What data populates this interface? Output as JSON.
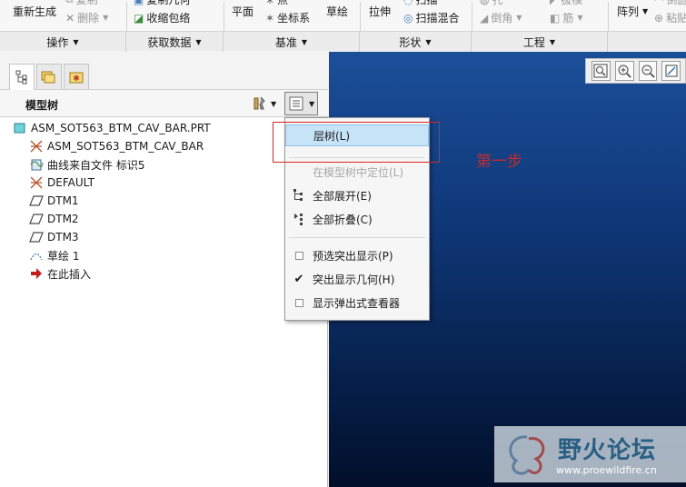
{
  "ribbon": {
    "row1": {
      "regenerate": "重新生成",
      "copy_geometry": "复制几何",
      "shrinkwrap": "收缩包络",
      "plane": "平面",
      "point": "点",
      "csys": "坐标系",
      "sketch": "草绘",
      "extrude": "拉伸",
      "sweep": "扫描",
      "swept_blend": "扫描混合",
      "hole": "孔",
      "draft": "拔模",
      "shell": "壳",
      "chamfer": "倒角",
      "round": "倒圆角",
      "rib": "筋",
      "pattern": "阵列",
      "copy": "复制",
      "paste": "粘贴",
      "delete": "删除"
    },
    "groups": {
      "operations": "操作",
      "get_data": "获取数据",
      "datum": "基准",
      "shapes": "形状",
      "engineering": "工程"
    }
  },
  "left_panel": {
    "tree_title": "模型树",
    "items": [
      "ASM_SOT563_BTM_CAV_BAR.PRT",
      "ASM_SOT563_BTM_CAV_BAR",
      "曲线来自文件 标识5",
      "DEFAULT",
      "DTM1",
      "DTM2",
      "DTM3",
      "草绘 1",
      "在此插入"
    ]
  },
  "menu": {
    "layer_tree": "层树(L)",
    "locate_in_tree": "在模型树中定位(L)",
    "expand_all": "全部展开(E)",
    "collapse_all": "全部折叠(C)",
    "preselection_highlight": "预选突出显示(P)",
    "highlight_geometry": "突出显示几何(H)",
    "show_popup_viewer": "显示弹出式查看器"
  },
  "annotation": "第一步",
  "watermark": {
    "name": "野火论坛",
    "url": "www.proewildfire.cn"
  },
  "colors": {
    "menu_highlight": "#c7e3f8",
    "annotation": "#c42a2a",
    "graphics_top": "#1b4f9a",
    "graphics_bottom": "#020f2a"
  }
}
